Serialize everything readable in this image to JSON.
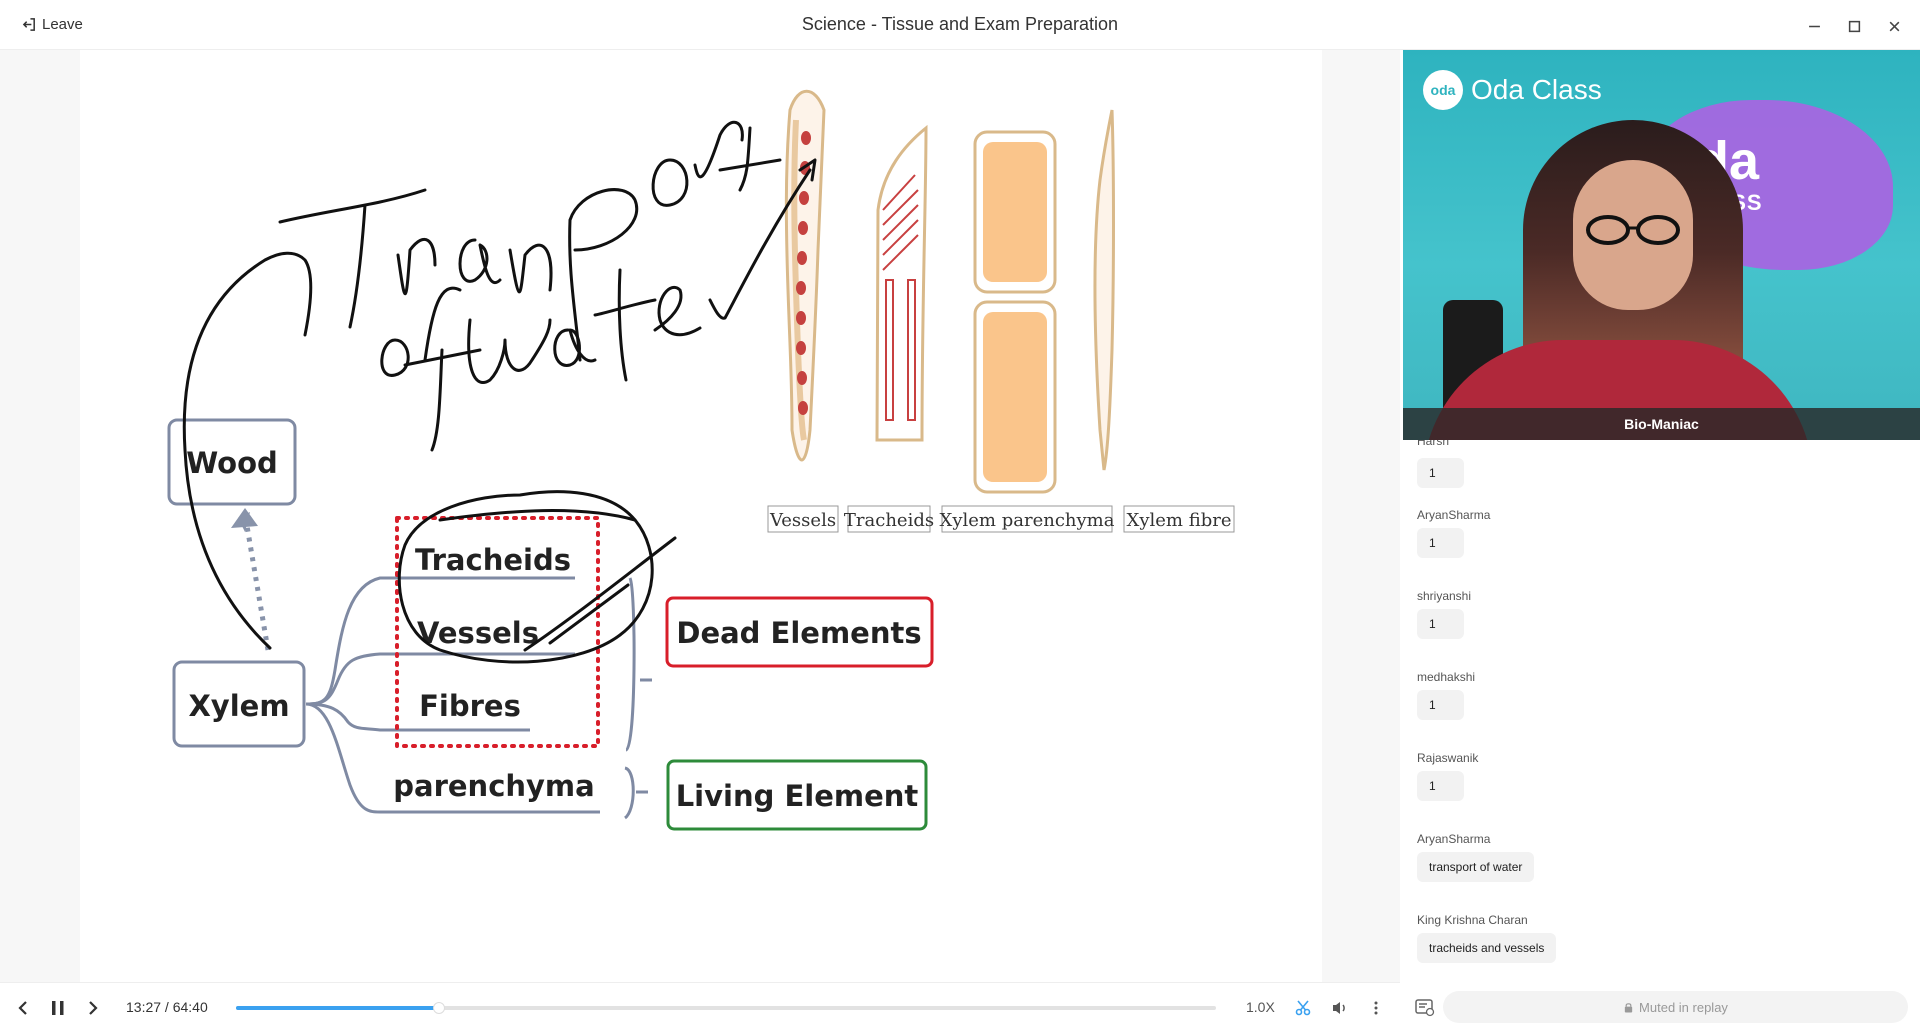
{
  "window": {
    "leave_label": "Leave",
    "title": "Science - Tissue and Exam Preparation"
  },
  "board": {
    "handwriting_1": "Transport",
    "handwriting_2": "of water",
    "boxes": {
      "wood": "Wood",
      "xylem": "Xylem",
      "tracheids": "Tracheids",
      "vessels": "Vessels",
      "fibres": "Fibres",
      "parenchyma": "parenchyma",
      "dead": "Dead Elements",
      "living": "Living Element"
    },
    "figure_labels": [
      "Vessels",
      "Tracheids",
      "Xylem parenchyma",
      "Xylem fibre"
    ]
  },
  "video": {
    "brand_badge": "oda",
    "brand": "Oda Class",
    "blob_main": "oda",
    "blob_sub": "CLASS",
    "presenter": "Bio-Maniac"
  },
  "chat": {
    "partial_name": "Harsh",
    "messages": [
      {
        "name": "",
        "text": "1"
      },
      {
        "name": "AryanSharma",
        "text": "1"
      },
      {
        "name": "shriyanshi",
        "text": "1"
      },
      {
        "name": "medhakshi",
        "text": "1"
      },
      {
        "name": "Rajaswanik",
        "text": "1"
      },
      {
        "name": "AryanSharma",
        "text": "transport of water"
      },
      {
        "name": "King Krishna Charan",
        "text": "tracheids and vessels"
      }
    ],
    "input_placeholder": "Muted in replay"
  },
  "player": {
    "time": "13:27 / 64:40",
    "progress_fraction": 0.2076,
    "speed": "1.0X",
    "accent": "#3aa1f0"
  }
}
